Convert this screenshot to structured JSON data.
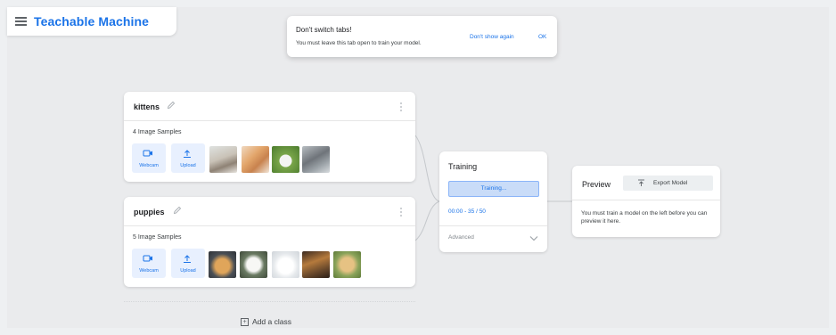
{
  "brand": {
    "title": "Teachable Machine"
  },
  "toast": {
    "title": "Don't switch tabs!",
    "message": "You must leave this tab open to train your model.",
    "dont_show": "Don't show again",
    "ok": "OK"
  },
  "classes": [
    {
      "name": "kittens",
      "samples": "4 Image Samples",
      "webcam": "Webcam",
      "upload": "Upload",
      "thumbs": [
        "kitten-photo",
        "kitten-photo",
        "kitten-photo",
        "kitten-photo"
      ]
    },
    {
      "name": "puppies",
      "samples": "5 Image Samples",
      "webcam": "Webcam",
      "upload": "Upload",
      "thumbs": [
        "puppy-photo",
        "puppy-photo",
        "puppy-photo",
        "puppy-photo",
        "puppy-photo"
      ]
    }
  ],
  "training": {
    "title": "Training",
    "button": "Training...",
    "progress": "00:00 - 35 / 50",
    "advanced": "Advanced"
  },
  "preview": {
    "title": "Preview",
    "export": "Export Model",
    "message": "You must train a model on the left before you can preview it here."
  },
  "add_class": "Add a class",
  "colors": {
    "accent": "#1a73e8",
    "button_bg": "#e8f0fe",
    "canvas": "#eaebed"
  }
}
